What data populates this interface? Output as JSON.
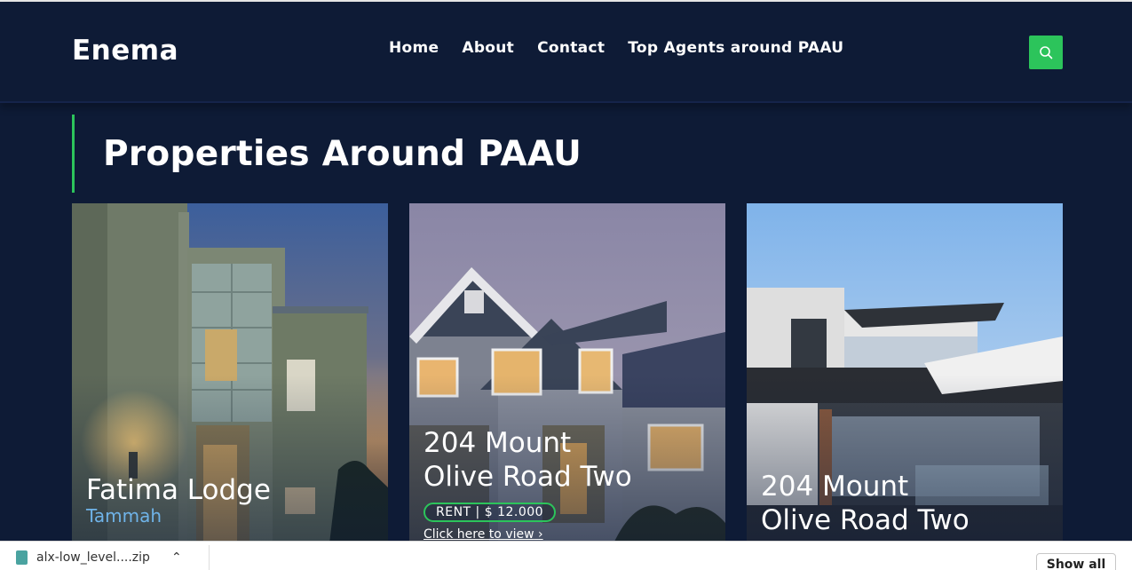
{
  "header": {
    "logo": "Enema",
    "nav": [
      "Home",
      "About",
      "Contact",
      "Top Agents around PAAU"
    ]
  },
  "section": {
    "title": "Properties Around PAAU"
  },
  "cards": [
    {
      "name": "Fatima Lodge",
      "sub": "Tammah"
    },
    {
      "name_line1": "204 Mount",
      "name_line2": "Olive Road Two",
      "badge": "RENT | $ 12.000",
      "link": "Click here to view"
    },
    {
      "name_line1": "204 Mount",
      "name_line2": "Olive Road Two"
    }
  ],
  "downloads": {
    "file": "alx-low_level....zip",
    "show_all": "Show all"
  },
  "colors": {
    "background": "#0e1b36",
    "accent": "#2cc45b",
    "subtitle": "#6fb3e8"
  }
}
